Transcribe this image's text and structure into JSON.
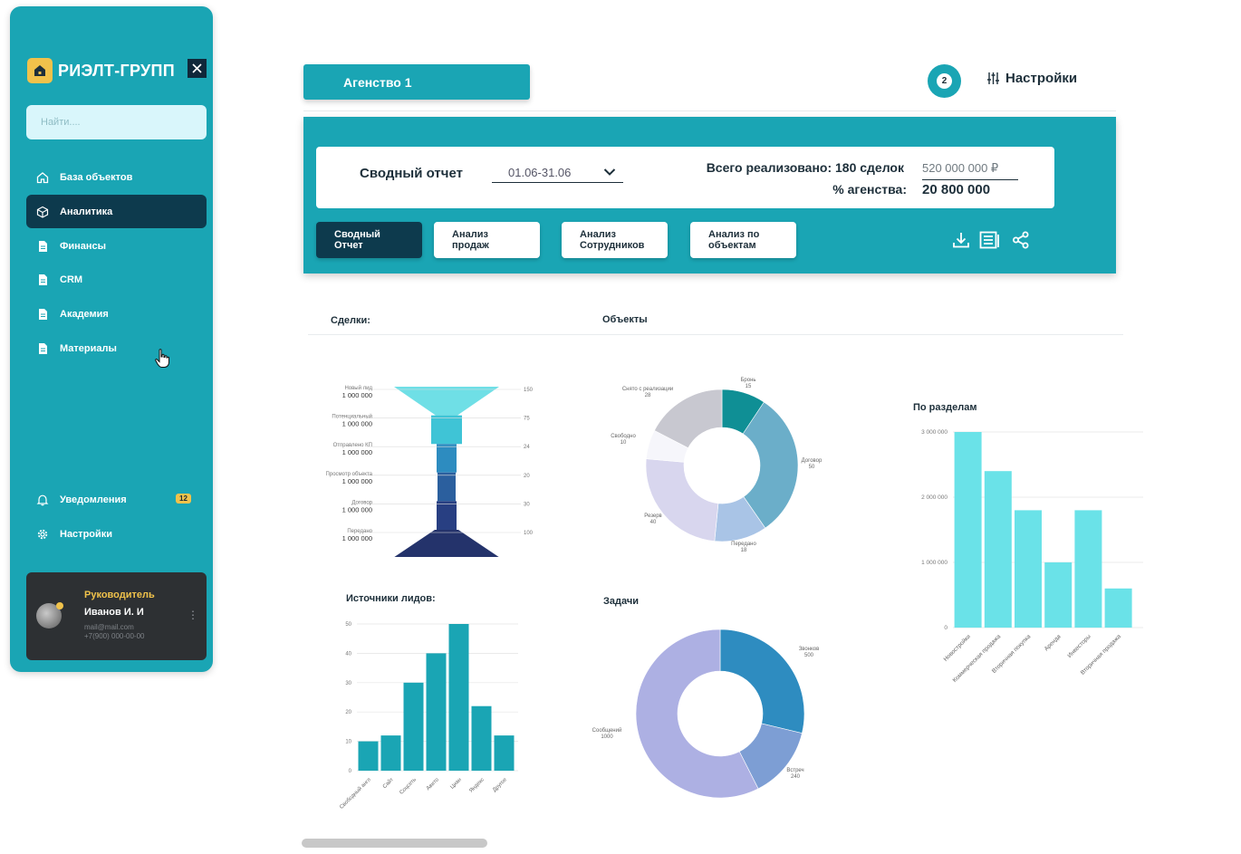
{
  "sidebar": {
    "brand": "РИЭЛТ-ГРУПП",
    "search_placeholder": "Найти....",
    "items": [
      {
        "label": "База объектов",
        "icon": "home-icon"
      },
      {
        "label": "Аналитика",
        "icon": "cube-icon",
        "active": true
      },
      {
        "label": "Финансы",
        "icon": "document-icon"
      },
      {
        "label": "CRM",
        "icon": "document-icon"
      },
      {
        "label": "Академия",
        "icon": "document-icon"
      },
      {
        "label": "Материалы",
        "icon": "document-icon"
      }
    ],
    "notifications_label": "Уведомления",
    "notifications_count": "12",
    "settings_label": "Настройки",
    "profile": {
      "role": "Руководитель",
      "name": "Иванов И. И",
      "email": "mail@mail.com",
      "phone": "+7(900) 000-00-00"
    }
  },
  "header": {
    "agency_tab": "Агенство 1",
    "notification_count": "2",
    "settings_label": "Настройки"
  },
  "report": {
    "title": "Сводный отчет",
    "period": "01.06-31.06",
    "total_label": "Всего реализовано: 180 сделок",
    "total_value": "520 000 000 ₽",
    "agency_pct_label": "% агенства:",
    "agency_pct_value": "20 800 000",
    "tabs": [
      {
        "label_line1": "Сводный",
        "label_line2": "Отчет",
        "active": true
      },
      {
        "label_line1": "Анализ",
        "label_line2": "продаж"
      },
      {
        "label_line1": "Анализ",
        "label_line2": "Сотрудников"
      },
      {
        "label_line1": "Анализ по",
        "label_line2": "объектам"
      }
    ]
  },
  "sections": {
    "deals": "Сделки:",
    "objects": "Объекты",
    "by_sections": "По разделам",
    "lead_sources": "Источники лидов:",
    "tasks": "Задачи"
  },
  "chart_data": [
    {
      "type": "funnel",
      "title": "Сделки:",
      "stages": [
        {
          "name": "Новый лид",
          "amount": "1 000 000",
          "count": 150
        },
        {
          "name": "Потенциальный",
          "amount": "1 000 000",
          "count": 75
        },
        {
          "name": "Отправлено КП",
          "amount": "1 000 000",
          "count": 24
        },
        {
          "name": "Просмотр объекта",
          "amount": "1 000 000",
          "count": 20
        },
        {
          "name": "Договор",
          "amount": "1 000 000",
          "count": 30
        },
        {
          "name": "Передано",
          "amount": "1 000 000",
          "count": 100
        }
      ],
      "colors": [
        "#6fdfe6",
        "#3fc4d6",
        "#2d8cc0",
        "#2b5f9e",
        "#283f82",
        "#24336b"
      ]
    },
    {
      "type": "pie",
      "title": "Объекты",
      "slices": [
        {
          "label": "Бронь",
          "value": 15,
          "color": "#0f8f95"
        },
        {
          "label": "Договор",
          "value": 50,
          "color": "#6baec9"
        },
        {
          "label": "Передано",
          "value": 18,
          "color": "#a9c4e6"
        },
        {
          "label": "Резерв",
          "value": 40,
          "color": "#d8d6ee"
        },
        {
          "label": "Свободно",
          "value": 10,
          "color": "#f6f6fb"
        },
        {
          "label": "Снято с реализации",
          "value": 28,
          "color": "#c8c8d0"
        }
      ]
    },
    {
      "type": "bar",
      "title": "По разделам",
      "categories": [
        "Новостройки",
        "Коммерческая продажа",
        "Вторичная покупка",
        "Аренда",
        "Инвесторы",
        "Вторичная продажа"
      ],
      "values": [
        3000000,
        2400000,
        1800000,
        1000000,
        1800000,
        600000
      ],
      "yticks": [
        "0",
        "1 000 000",
        "2 000 000",
        "3 000 000"
      ],
      "ylim": [
        0,
        3000000
      ],
      "color": "#6ae2e8"
    },
    {
      "type": "bar",
      "title": "Источники лидов:",
      "categories": [
        "Свободный англ",
        "Сайт",
        "Соцсеть",
        "Авито",
        "Циан",
        "Яндекс",
        "Другое"
      ],
      "values": [
        10,
        12,
        30,
        40,
        50,
        22,
        12
      ],
      "yticks": [
        "0",
        "10",
        "20",
        "30",
        "40",
        "50"
      ],
      "ylim": [
        0,
        50
      ],
      "color": "#1aa5b4"
    },
    {
      "type": "pie",
      "title": "Задачи",
      "slices": [
        {
          "label": "Звонков",
          "value": 500,
          "color": "#2e8cc0"
        },
        {
          "label": "Встреч",
          "value": 240,
          "color": "#7d9ed4"
        },
        {
          "label": "Сообщений",
          "value": 1000,
          "color": "#adb0e3"
        }
      ]
    }
  ]
}
